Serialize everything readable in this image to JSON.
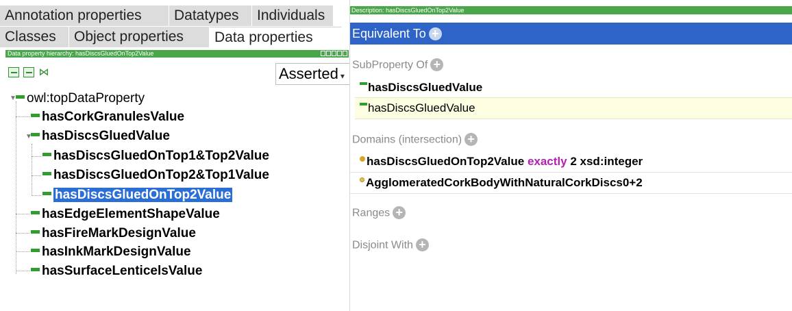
{
  "tabs": {
    "row1": [
      "Annotation properties",
      "Datatypes",
      "Individuals"
    ],
    "row2": [
      "Classes",
      "Object properties",
      "Data properties"
    ],
    "active": "Data properties"
  },
  "hierarchy": {
    "title": "Data property hierarchy: hasDiscsGluedOnTop2Value",
    "mode": "Asserted",
    "root": "owl:topDataProperty",
    "items": [
      "hasCorkGranulesValue",
      "hasDiscsGluedValue",
      "hasDiscsGluedOnTop1&Top2Value",
      "hasDiscsGluedOnTop2&Top1Value",
      "hasDiscsGluedOnTop2Value",
      "hasEdgeElementShapeValue",
      "hasFireMarkDesignValue",
      "hasInkMarkDesignValue",
      "hasSurfaceLenticelsValue"
    ],
    "selected": "hasDiscsGluedOnTop2Value"
  },
  "description": {
    "title": "Description: hasDiscsGluedOnTop2Value",
    "equivalent_to": "Equivalent To",
    "subproperty_of": "SubProperty Of",
    "subproperties": [
      "hasDiscsGluedValue",
      "hasDiscsGluedValue"
    ],
    "domains": "Domains (intersection)",
    "domain_items": {
      "first_prop": "hasDiscsGluedOnTop2Value",
      "first_kw": "exactly",
      "first_rest": "2 xsd:integer",
      "second": "AgglomeratedCorkBodyWithNaturalCorkDiscs0+2"
    },
    "ranges": "Ranges",
    "disjoint_with": "Disjoint With"
  },
  "colors": {
    "header_green": "#4aa64a",
    "selection_blue": "#2a6ed6",
    "equivalent_blue": "#2e64c8",
    "keyword_purple": "#b21fb2",
    "highlight_yellow": "#fdfde2"
  }
}
